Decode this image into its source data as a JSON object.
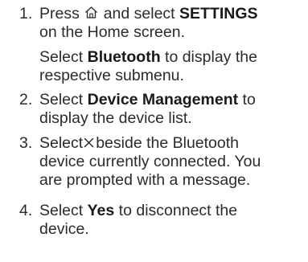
{
  "steps": [
    {
      "number": "1.",
      "line1_pre": "Press",
      "line1_mid": "and select",
      "line1_bold": "SETTINGS",
      "line2": "on the Home screen.",
      "icon": "home-icon"
    },
    {
      "sub_pre": "Select",
      "sub_bold": "Bluetooth",
      "sub_post": "to display the",
      "sub_line2": "respective submenu."
    },
    {
      "number": "2.",
      "pre": "Select",
      "bold": "Device Management",
      "post": "to",
      "line2": "display the device list."
    },
    {
      "number": "3.",
      "pre": "Select",
      "icon": "close-x-icon",
      "post": "beside the Bluetooth",
      "line2": "device currently connected. You",
      "line3": "are prompted with a message."
    },
    {
      "number": "4.",
      "pre": "Select",
      "bold": "Yes",
      "post": "to disconnect the",
      "line2": "device."
    }
  ]
}
